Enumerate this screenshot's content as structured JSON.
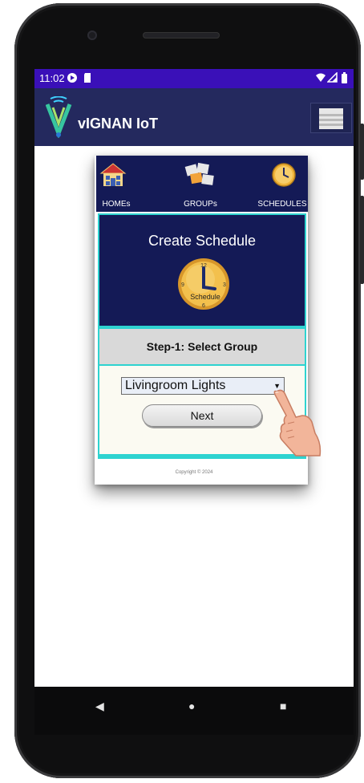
{
  "status_bar": {
    "time": "11:02",
    "icons": [
      "app-notification-icon",
      "sim-card-icon",
      "wifi-icon",
      "signal-icon",
      "battery-icon"
    ]
  },
  "app_bar": {
    "title": "vIGNAN IoT",
    "logo_icon": "vignan-logo-icon",
    "menu_icon": "hamburger-menu-icon"
  },
  "nav": {
    "items": [
      {
        "label": "HOMEs",
        "icon": "house-icon"
      },
      {
        "label": "GROUPs",
        "icon": "puzzle-icon"
      },
      {
        "label": "SCHEDULES",
        "icon": "clock-icon"
      }
    ]
  },
  "panel": {
    "title": "Create Schedule",
    "clock_label": "Schedule",
    "clock_numbers": [
      "12",
      "3",
      "6",
      "9"
    ],
    "step_label": "Step-1: Select Group",
    "select_value": "Livingroom Lights",
    "next_label": "Next"
  },
  "footer": {
    "copyright": "Copyright © 2024"
  },
  "system_nav": {
    "back": "◀",
    "home": "●",
    "recents": "■"
  },
  "colors": {
    "status_bar": "#3a10b8",
    "app_bar": "#24295e",
    "card_navy": "#141a56",
    "accent_cyan": "#2ed3d0",
    "step_bar": "#d9d9d9",
    "clock_gold": "#f0b43a"
  }
}
